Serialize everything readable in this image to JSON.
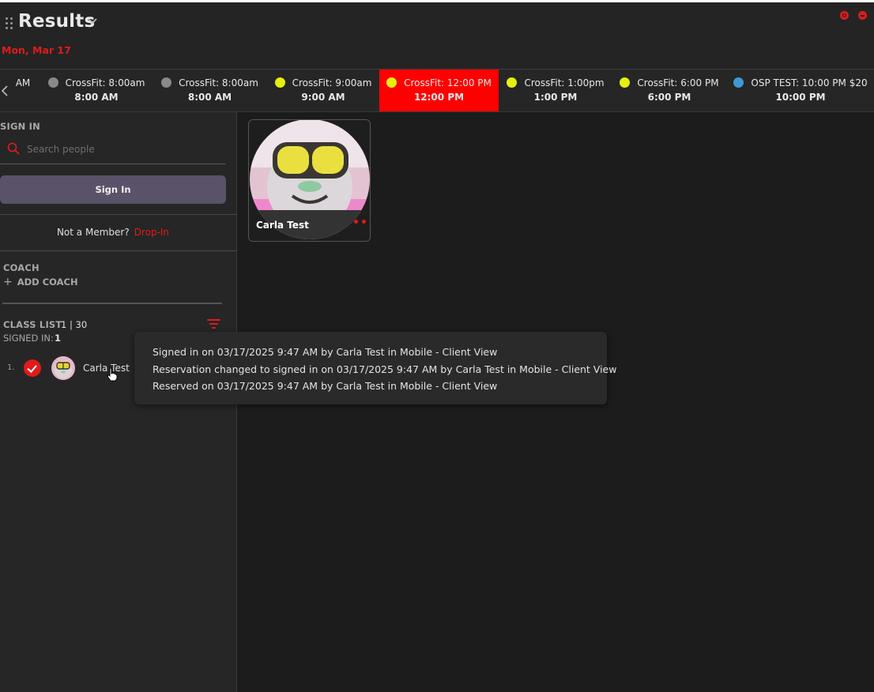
{
  "header": {
    "title": "Results",
    "date": "Mon, Mar 17"
  },
  "classbar": {
    "tabs": [
      {
        "name": "AM",
        "time": "",
        "dot_color": "",
        "active": false
      },
      {
        "name": "CrossFit: 8:00am",
        "time": "8:00 AM",
        "dot_color": "#8a8a8a",
        "active": false
      },
      {
        "name": "CrossFit: 8:00am",
        "time": "8:00 AM",
        "dot_color": "#8a8a8a",
        "active": false
      },
      {
        "name": "CrossFit: 9:00am",
        "time": "9:00 AM",
        "dot_color": "#e6f00f",
        "active": false
      },
      {
        "name": "CrossFit: 12:00 PM",
        "time": "12:00 PM",
        "dot_color": "#e6f00f",
        "active": true
      },
      {
        "name": "CrossFit: 1:00pm",
        "time": "1:00 PM",
        "dot_color": "#e6f00f",
        "active": false
      },
      {
        "name": "CrossFit: 6:00 PM",
        "time": "6:00 PM",
        "dot_color": "#e6f00f",
        "active": false
      },
      {
        "name": "OSP TEST: 10:00 PM $20",
        "time": "10:00 PM",
        "dot_color": "#3d9ad1",
        "active": false
      }
    ]
  },
  "sidebar": {
    "sign_in_label": "SIGN IN",
    "search_placeholder": "Search people",
    "sign_in_button": "Sign In",
    "not_member_text": "Not a Member?",
    "drop_in_link": "Drop-In",
    "coach_label": "COACH",
    "add_coach": "ADD COACH",
    "class_list_label": "CLASS LIST",
    "class_list_count": "1 | 30",
    "signed_in_label": "SIGNED IN:",
    "signed_in_count": "1",
    "rows": [
      {
        "index": "1.",
        "name": "Carla Test"
      }
    ]
  },
  "card": {
    "name": "Carla Test",
    "menu": "•••"
  },
  "tooltip": {
    "lines": [
      "Signed in on 03/17/2025 9:47 AM by Carla Test in Mobile - Client View",
      "Reservation changed to signed in on 03/17/2025 9:47 AM by Carla Test in Mobile - Client View",
      "Reserved on 03/17/2025 9:47 AM by Carla Test in Mobile - Client View"
    ]
  },
  "colors": {
    "accent": "#e01b1b",
    "active_tab": "#ff0000",
    "sign_in_button": "#5a5268"
  }
}
